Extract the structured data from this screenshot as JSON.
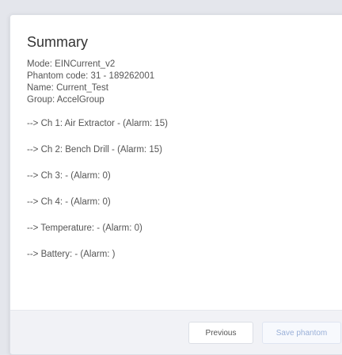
{
  "summary": {
    "title": "Summary",
    "mode": "Mode: EINCurrent_v2",
    "phantom_code": "Phantom code: 31 - 189262001",
    "name": "Name: Current_Test",
    "group": "Group: AccelGroup"
  },
  "channels": [
    "--> Ch 1: Air Extractor - (Alarm: 15)",
    "--> Ch 2: Bench Drill - (Alarm: 15)",
    "--> Ch 3: - (Alarm: 0)",
    "--> Ch 4: - (Alarm: 0)",
    "--> Temperature: - (Alarm: 0)",
    "--> Battery: - (Alarm: )"
  ],
  "footer": {
    "previous_label": "Previous",
    "save_label": "Save phantom"
  },
  "colors": {
    "background": "#e4e6ec",
    "footer": "#f1f2f6",
    "save_text_disabled": "#9ab0d8"
  }
}
